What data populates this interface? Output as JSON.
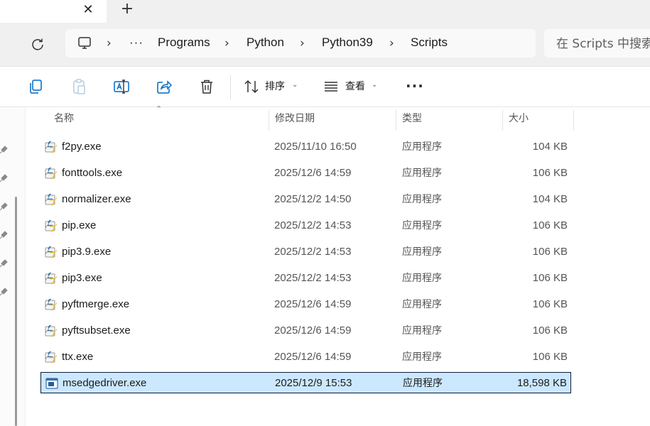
{
  "tabbar": {
    "close_glyph": "✕",
    "new_tab_glyph": "+"
  },
  "breadcrumb": {
    "overflow": "···",
    "items": [
      "Programs",
      "Python",
      "Python39",
      "Scripts"
    ],
    "separator": "›"
  },
  "search": {
    "placeholder": "在 Scripts 中搜索"
  },
  "toolbar": {
    "sort_label": "排序",
    "view_label": "查看",
    "more_label": "···",
    "icons": [
      "copy-icon",
      "paste-icon",
      "rename-icon",
      "share-icon",
      "delete-icon",
      "sort-icon",
      "view-icon"
    ]
  },
  "columns": {
    "name": "名称",
    "date": "修改日期",
    "type": "类型",
    "size": "大小"
  },
  "files": [
    {
      "name": "f2py.exe",
      "date": "2025/11/10 16:50",
      "type": "应用程序",
      "size": "104 KB",
      "icon": "python-exe-icon"
    },
    {
      "name": "fonttools.exe",
      "date": "2025/12/6 14:59",
      "type": "应用程序",
      "size": "106 KB",
      "icon": "python-exe-icon"
    },
    {
      "name": "normalizer.exe",
      "date": "2025/12/2 14:50",
      "type": "应用程序",
      "size": "104 KB",
      "icon": "python-exe-icon"
    },
    {
      "name": "pip.exe",
      "date": "2025/12/2 14:53",
      "type": "应用程序",
      "size": "106 KB",
      "icon": "python-exe-icon"
    },
    {
      "name": "pip3.9.exe",
      "date": "2025/12/2 14:53",
      "type": "应用程序",
      "size": "106 KB",
      "icon": "python-exe-icon"
    },
    {
      "name": "pip3.exe",
      "date": "2025/12/2 14:53",
      "type": "应用程序",
      "size": "106 KB",
      "icon": "python-exe-icon"
    },
    {
      "name": "pyftmerge.exe",
      "date": "2025/12/6 14:59",
      "type": "应用程序",
      "size": "106 KB",
      "icon": "python-exe-icon"
    },
    {
      "name": "pyftsubset.exe",
      "date": "2025/12/6 14:59",
      "type": "应用程序",
      "size": "106 KB",
      "icon": "python-exe-icon"
    },
    {
      "name": "ttx.exe",
      "date": "2025/12/6 14:59",
      "type": "应用程序",
      "size": "106 KB",
      "icon": "python-exe-icon"
    },
    {
      "name": "msedgedriver.exe",
      "date": "2025/12/9 15:53",
      "type": "应用程序",
      "size": "18,598 KB",
      "icon": "app-exe-icon",
      "selected": true
    }
  ],
  "colors": {
    "selection_bg": "#cce8ff",
    "selection_border": "#0a1d33",
    "chrome_bg": "#f0f0f0",
    "accent": "#0067c0"
  }
}
